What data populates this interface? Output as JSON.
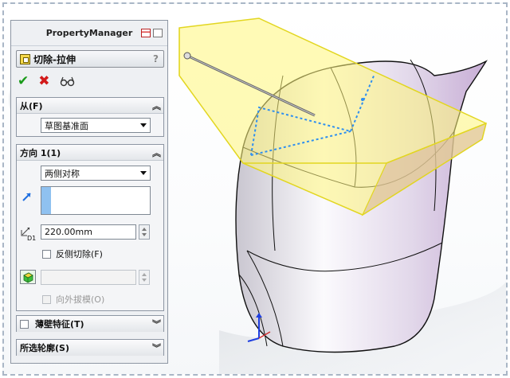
{
  "panel": {
    "title": "PropertyManager",
    "feature_name": "切除-拉伸",
    "help_icon": "?",
    "actions": {
      "ok": "✔",
      "cancel": "✖"
    }
  },
  "from_section": {
    "label": "从(F)",
    "selected": "草图基准面"
  },
  "direction_section": {
    "label": "方向 1(1)",
    "end_condition": "两侧对称",
    "depth_label": "D1",
    "depth_value": "220.00mm",
    "flip_side_label": "反侧切除(F)",
    "draft_outward_label": "向外拔模(O)"
  },
  "thin_section": {
    "label": "薄壁特征(T)"
  },
  "contours_section": {
    "label": "所选轮廓(S)"
  },
  "colors": {
    "accent_blue": "#3b82f6",
    "cut_yellow": "#fff67a",
    "sketch_blue": "#2e8ff0"
  }
}
